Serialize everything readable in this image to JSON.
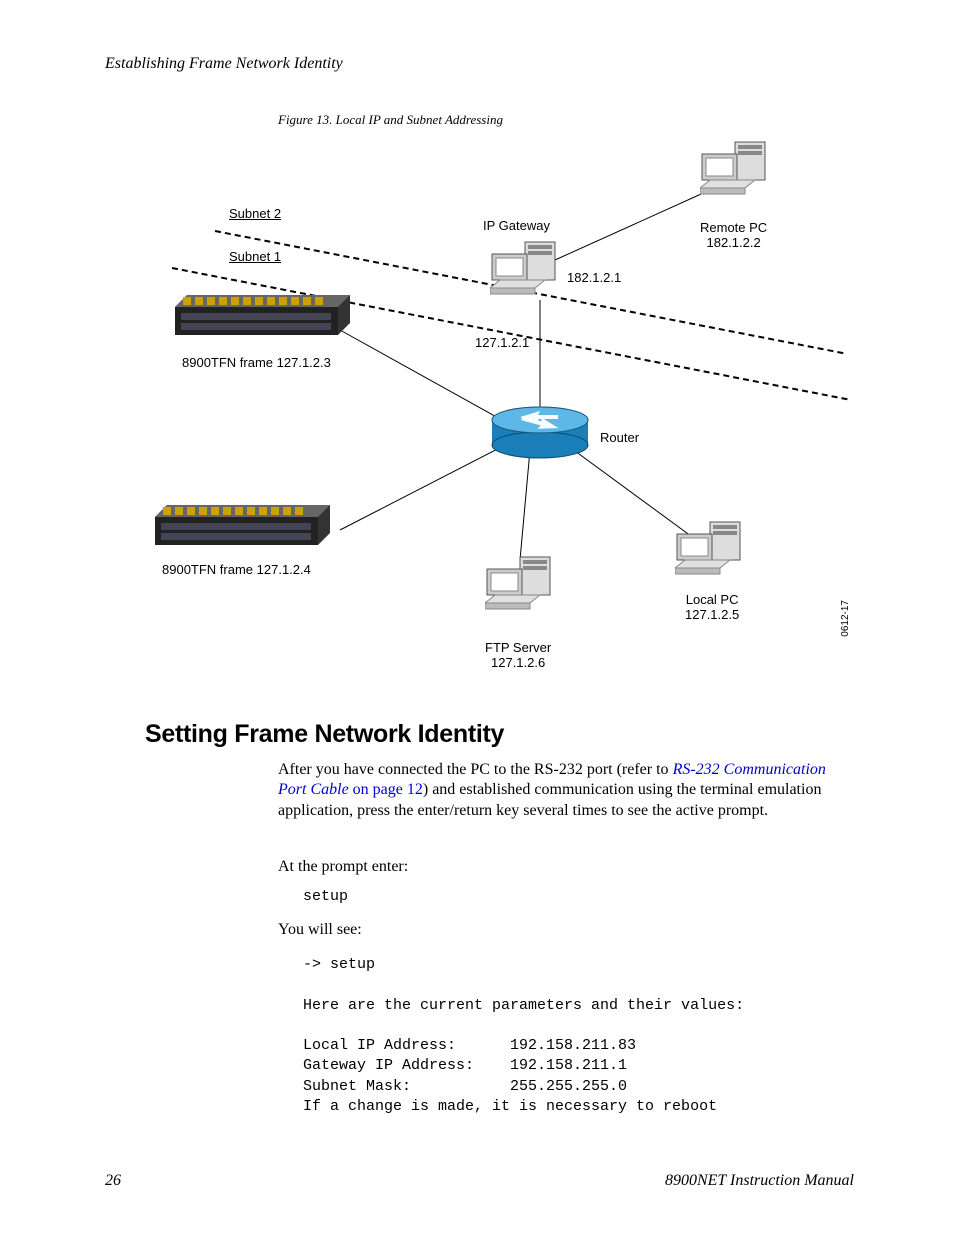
{
  "header": "Establishing Frame Network Identity",
  "figure_caption": "Figure 13.  Local IP and Subnet Addressing",
  "diagram": {
    "subnet2_label": "Subnet 2",
    "subnet1_label": "Subnet 1",
    "ip_gateway_label": "IP Gateway",
    "ip_gateway_upper_ip": "182.1.2.1",
    "ip_gateway_lower_ip": "127.1.2.1",
    "remote_pc_label": "Remote PC\n182.1.2.2",
    "frame1_label": "8900TFN frame 127.1.2.3",
    "frame2_label": "8900TFN frame 127.1.2.4",
    "router_label": "Router",
    "ftp_server_label": "FTP Server\n127.1.2.6",
    "local_pc_label": "Local PC\n127.1.2.5",
    "figure_id": "0612-17"
  },
  "section_heading": "Setting Frame Network Identity",
  "body": {
    "para1_pre": "After you have connected the PC to the RS-232 port (refer to ",
    "para1_link": "RS-232 Communication Port Cable",
    "para1_link_page": " on page 12",
    "para1_post": ") and established communication using the terminal emulation application, press the enter/return key several times to see the active prompt.",
    "prompt_label": "At the prompt enter:",
    "prompt_cmd": "setup",
    "see_label": "You will see:",
    "terminal": "-> setup\n\nHere are the current parameters and their values:\n\nLocal IP Address:      192.158.211.83\nGateway IP Address:    192.158.211.1\nSubnet Mask:           255.255.255.0\nIf a change is made, it is necessary to reboot"
  },
  "page_number": "26",
  "manual_title": "8900NET  Instruction Manual"
}
